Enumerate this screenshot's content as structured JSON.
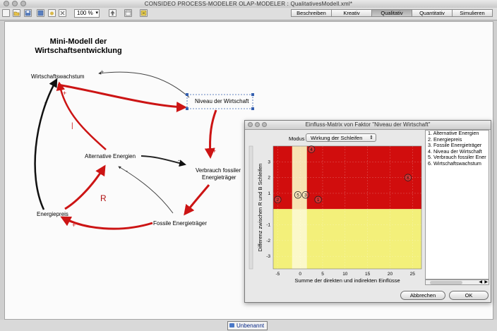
{
  "window": {
    "title": "CONSIDEO PROCESS-MODELER OLAP-MODELER : QualitativesModell.xml*"
  },
  "toolbar": {
    "zoom_value": "100 %",
    "mode_tabs": [
      {
        "label": "Beschreiben",
        "active": false
      },
      {
        "label": "Kreativ",
        "active": false
      },
      {
        "label": "Qualitativ",
        "active": true
      },
      {
        "label": "Quantitativ",
        "active": false
      },
      {
        "label": "Simulieren",
        "active": false
      }
    ]
  },
  "model": {
    "title_line1": "Mini-Modell der",
    "title_line2": "Wirtschaftsentwicklung",
    "nodes": {
      "wachstum": "Wirtschaftswachstum",
      "niveau": "Niveau der Wirtschaft",
      "alternative": "Alternative Energien",
      "verbrauch_line1": "Verbrauch fossiler",
      "verbrauch_line2": "Energieträger",
      "energiepreis": "Energiepreis",
      "fossile": "Fossile Energieträger"
    },
    "loop_label": "R",
    "signs": {
      "plus": "+",
      "minus": "-"
    },
    "colors": {
      "red": "#cc1414",
      "black": "#111111"
    }
  },
  "dialog": {
    "title": "Einfluss-Matrix von Faktor \"Niveau der Wirtschaft\"",
    "modus_label": "Modus",
    "modus_value": "Wirkung der Schleifen",
    "factor_list": [
      "1. Alternative Energien",
      "2. Energiepreis",
      "3. Fossile Energieträger",
      "4. Niveau der Wirtschaft",
      "5. Verbrauch fossiler Ener",
      "6. Wirtschaftswachstum"
    ],
    "cancel_label": "Abbrechen",
    "ok_label": "OK"
  },
  "matrix": {
    "xlabel": "Summe der direkten und indirekten Einflüsse",
    "ylabel": "Differenz zwischen R und B Schleifen",
    "x_ticks": [
      -5,
      0,
      5,
      10,
      15,
      20,
      25
    ],
    "y_ticks": [
      3,
      2,
      1,
      -1,
      -2,
      -3
    ],
    "xlim": [
      -6,
      27
    ],
    "ylim": [
      -3.8,
      4
    ],
    "colors": {
      "red_zone": "#d10d0d",
      "yellow_zone": "#f3f07a",
      "highlight_top": "#f7e2b2",
      "highlight_bottom": "#fbf8c9"
    },
    "points": [
      {
        "id": "2",
        "x": -5,
        "y": 0.6
      },
      {
        "id": "5",
        "x": -0.5,
        "y": 0.9
      },
      {
        "id": "3",
        "x": 1.2,
        "y": 0.9
      },
      {
        "id": "1",
        "x": 4,
        "y": 0.6
      },
      {
        "id": "4",
        "x": 2.5,
        "y": 3.8
      },
      {
        "id": "6",
        "x": 24,
        "y": 2
      }
    ]
  },
  "statusbar": {
    "tab_label": "Unbenannt"
  }
}
